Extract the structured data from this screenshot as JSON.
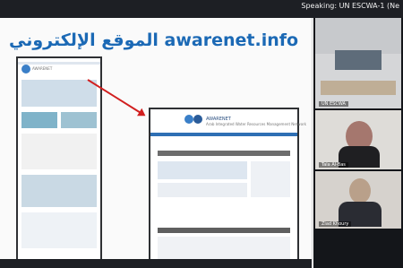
{
  "topbar": {
    "speaking_label": "Speaking: UN ESCWA-1 (Ne"
  },
  "slide": {
    "title": "الموقع الإلكتروني awarenet.info",
    "shot_big_label": "AWARENET",
    "shot_big_subtitle": "Arab Integrated Water Resources Management Network",
    "shot_small_label": "AWARENET"
  },
  "participants": [
    {
      "name": "UN ESCWA",
      "role": "room-camera"
    },
    {
      "name": "Tala Al-Bas",
      "role": "speaker"
    },
    {
      "name": "Ziad Khoury",
      "role": "participant"
    }
  ],
  "colors": {
    "title": "#1b69b5",
    "arrow": "#d11f1f",
    "dark": "#1d1f24"
  }
}
